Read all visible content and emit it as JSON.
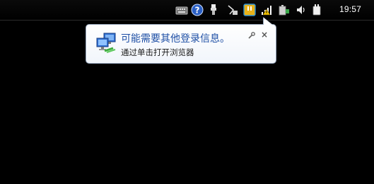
{
  "taskbar": {
    "clock": "19:57",
    "tray_icons": [
      "keyboard-icon",
      "help-icon",
      "usb-device-icon",
      "network-flag-icon",
      "app-icon",
      "network-signal-icon",
      "battery-icon",
      "volume-icon",
      "power-icon"
    ]
  },
  "balloon": {
    "title": "可能需要其他登录信息。",
    "message": "通过单击打开浏览器",
    "close_label": "×"
  }
}
